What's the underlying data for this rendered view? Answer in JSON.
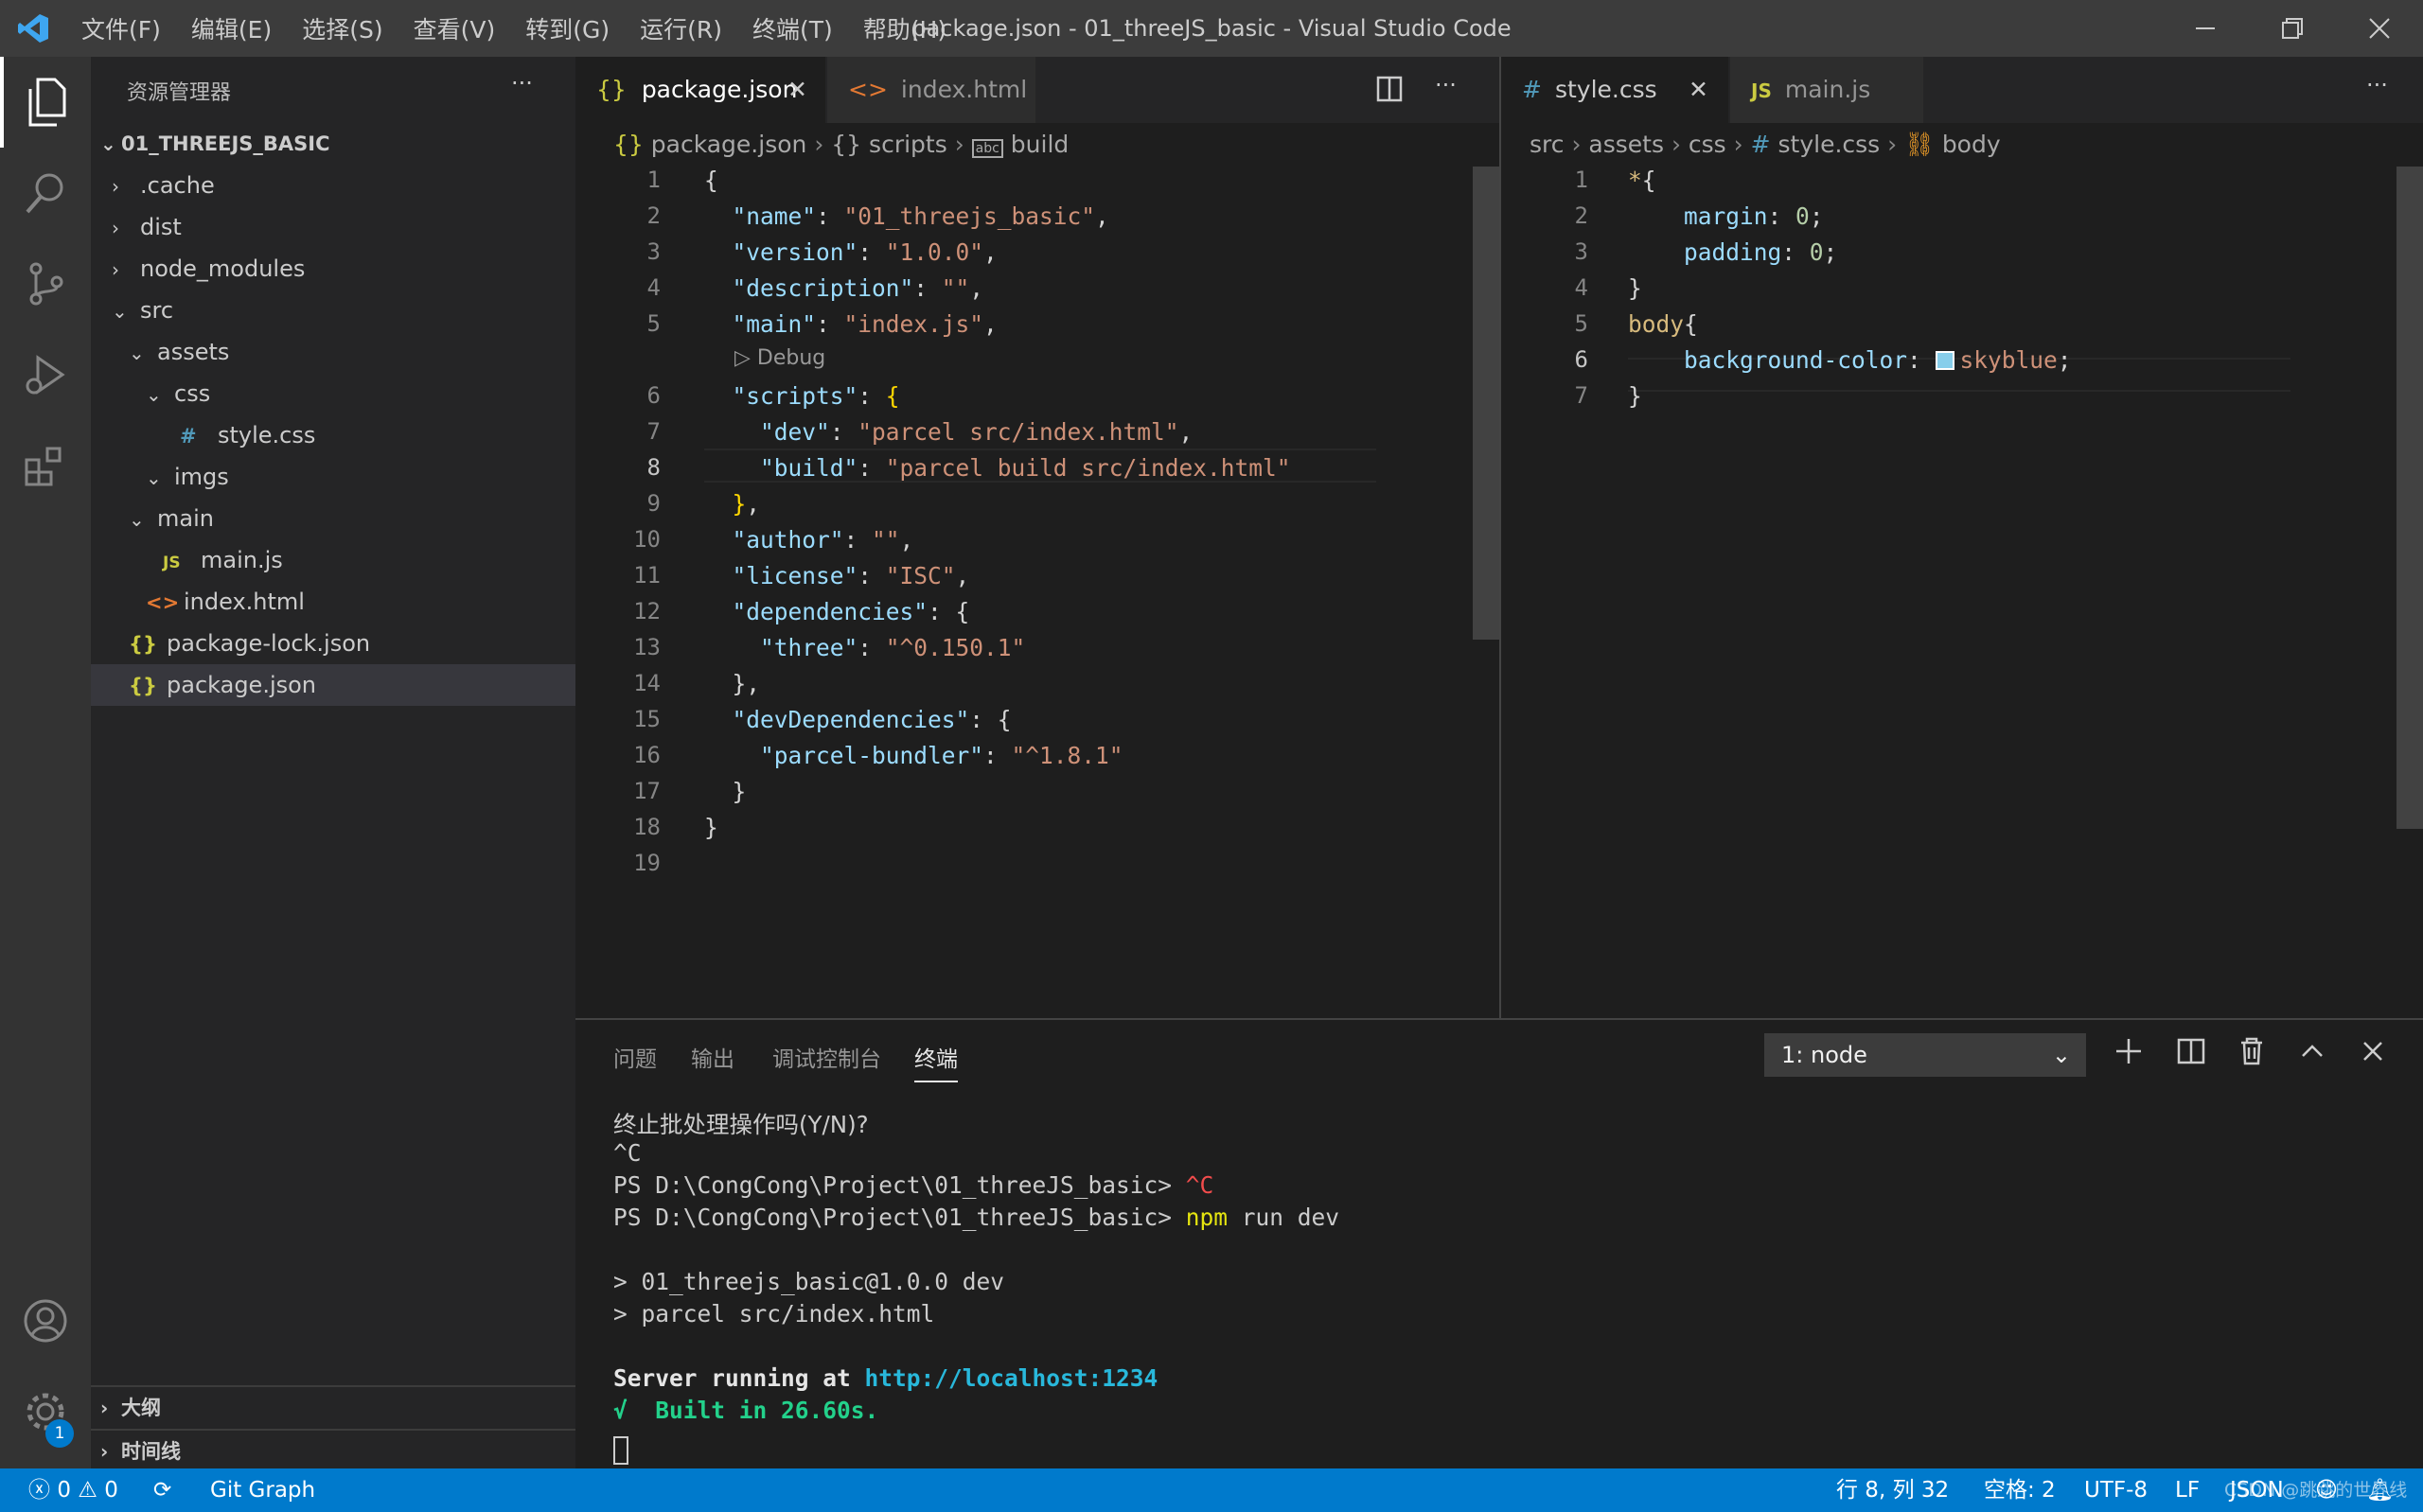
{
  "window": {
    "title": "package.json - 01_threeJS_basic - Visual Studio Code",
    "menus": [
      "文件(F)",
      "编辑(E)",
      "选择(S)",
      "查看(V)",
      "转到(G)",
      "运行(R)",
      "终端(T)",
      "帮助(H)"
    ]
  },
  "sidebar": {
    "title": "资源管理器",
    "more": "···",
    "project": "01_THREEJS_BASIC",
    "items": [
      {
        "label": ".cache",
        "kind": "folder-closed",
        "indent": 0
      },
      {
        "label": "dist",
        "kind": "folder-closed",
        "indent": 0
      },
      {
        "label": "node_modules",
        "kind": "folder-closed",
        "indent": 0
      },
      {
        "label": "src",
        "kind": "folder-open",
        "indent": 0
      },
      {
        "label": "assets",
        "kind": "folder-open",
        "indent": 1
      },
      {
        "label": "css",
        "kind": "folder-open",
        "indent": 2
      },
      {
        "label": "style.css",
        "kind": "css",
        "indent": 3,
        "icon": "#"
      },
      {
        "label": "imgs",
        "kind": "folder-open",
        "indent": 2
      },
      {
        "label": "main",
        "kind": "folder-open",
        "indent": 1
      },
      {
        "label": "main.js",
        "kind": "js",
        "indent": 2,
        "icon": "JS"
      },
      {
        "label": "index.html",
        "kind": "html",
        "indent": 1,
        "icon": "<>"
      },
      {
        "label": "package-lock.json",
        "kind": "json",
        "indent": 0,
        "icon": "{}"
      },
      {
        "label": "package.json",
        "kind": "json",
        "indent": 0,
        "icon": "{}",
        "selected": true
      }
    ],
    "outline": "大纲",
    "timeline": "时间线"
  },
  "editor1": {
    "tabs": [
      {
        "label": "package.json",
        "icon": "{}",
        "active": true
      },
      {
        "label": "index.html",
        "icon": "<>"
      }
    ],
    "breadcrumb": [
      "package.json",
      "scripts",
      "build"
    ],
    "codelens": "Debug"
  },
  "editor2": {
    "tabs": [
      {
        "label": "style.css",
        "icon": "#",
        "active": true
      },
      {
        "label": "main.js",
        "icon": "JS"
      }
    ],
    "breadcrumb": [
      "src",
      "assets",
      "css",
      "style.css",
      "body"
    ]
  },
  "panel": {
    "tabs": [
      "问题",
      "输出",
      "调试控制台",
      "终端"
    ],
    "active_tab": "终端",
    "terminal_select": "1: node",
    "lines": [
      "终止批处理操作吗(Y/N)?",
      "^C",
      "PS D:\\CongCong\\Project\\01_threeJS_basic> ",
      "^C",
      "PS D:\\CongCong\\Project\\01_threeJS_basic> ",
      "npm",
      " run dev",
      "> 01_threejs_basic@1.0.0 dev",
      "> parcel src/index.html",
      "Server running at ",
      "http://localhost:1234",
      "√  Built in 26.60s."
    ]
  },
  "status": {
    "errors": "0",
    "warnings": "0",
    "git_graph": "Git Graph",
    "position": "行 8, 列 32",
    "spaces": "空格: 2",
    "encoding": "UTF-8",
    "eol": "LF",
    "language": "JSON",
    "notification_count": "1",
    "watermark": "CSDN @跳跳的世界线"
  },
  "colors": {
    "accent": "#007acc",
    "activity": "#333333",
    "sidebar": "#252526",
    "editor": "#1e1e1e",
    "swatch": "#87ceeb"
  }
}
